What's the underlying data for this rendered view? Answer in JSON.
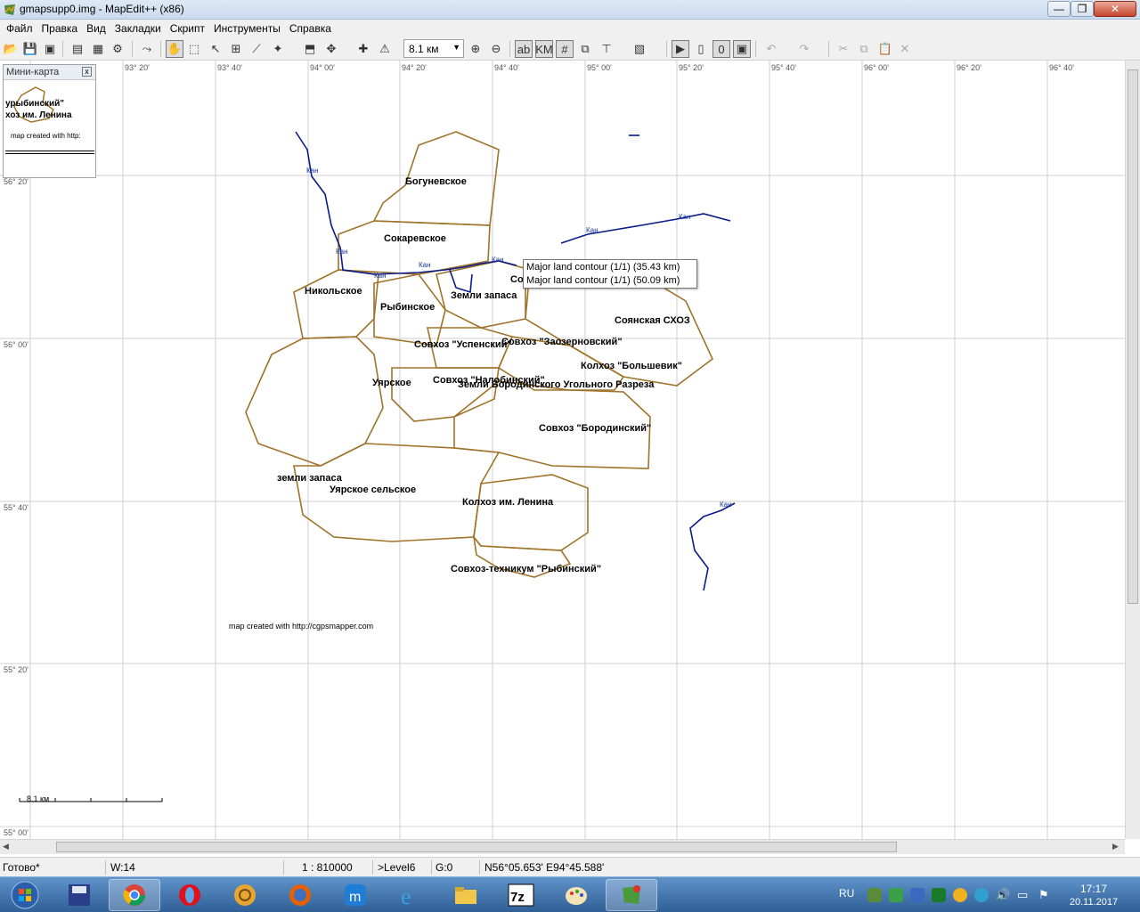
{
  "window": {
    "title": "gmapsupp0.img - MapEdit++ (x86)",
    "min_symbol": "—",
    "max_symbol": "❐",
    "close_symbol": "✕"
  },
  "menu": [
    "Файл",
    "Правка",
    "Вид",
    "Закладки",
    "Скрипт",
    "Инструменты",
    "Справка"
  ],
  "toolbar": {
    "scale_value": "8.1 км",
    "scale_arrow": "▼",
    "tool_icons": [
      "open-icon",
      "save-icon",
      "export-icon",
      "properties-icon",
      "layers-icon",
      "tools-icon",
      "route-icon",
      "hand-icon",
      "zoom-rect-icon",
      "select-icon",
      "edit-nodes-icon",
      "polyline-icon",
      "magic-wand-icon",
      "select-area-icon",
      "move-icon",
      "add-point-icon",
      "poi-icon",
      "zoom-in-icon",
      "zoom-out-icon",
      "label-icon",
      "km-icon",
      "grid-icon",
      "tree-icon",
      "split-icon",
      "image-icon",
      "layer-a-icon",
      "layer-b-icon",
      "layer-c-icon",
      "layer-d-icon",
      "undo-icon",
      "redo-icon",
      "cut-icon",
      "copy-icon",
      "paste-icon",
      "delete-icon"
    ]
  },
  "minimap": {
    "title": "Мини-карта",
    "close_symbol": "x",
    "text1": "урыбинский\"",
    "text2": "хоз им. Ленина",
    "credit": "map created with http:"
  },
  "grid": {
    "longitudes": [
      "93° 20'",
      "93° 40'",
      "94° 00'",
      "94° 20'",
      "94° 40'",
      "95° 00'",
      "95° 20'",
      "95° 40'",
      "96° 00'",
      "96° 20'",
      "96° 40'"
    ],
    "latitudes": [
      "56° 20'",
      "56° 00'",
      "55° 40'",
      "55° 20'",
      "55° 00'"
    ]
  },
  "map_labels": [
    "Богуневское",
    "Сокаревское",
    "Никольское",
    "Рыбинское",
    "Земли запаса",
    "Соянская СХОЗ",
    "Совхоз \"Успенский\"",
    "Совхоз \"Заозерновский\"",
    "Колхоз \"Большевик\"",
    "Уярское",
    "Совхоз \"Налобинский\"",
    "Земли Бородинского Угольного Разреза",
    "Совхоз \"Бородинский\"",
    "земли запаса",
    "Уярское сельское",
    "Колхоз им. Ленина",
    "Совхоз-техникум \"Рыбинский\"",
    "Со"
  ],
  "river_labels": [
    "Кан",
    "Кан",
    "Кан",
    "Кан",
    "Кан",
    "Кан",
    "Кан",
    "Кан"
  ],
  "credit": "map created with http://cgpsmapper.com",
  "scalebar": "8.1 км",
  "tooltip": {
    "line1": "Major land contour (1/1) (35.43 km)",
    "line2": "Major land contour (1/1) (50.09 km)"
  },
  "statusbar": {
    "status": "Готово*",
    "w": "W:14",
    "scale": "1 : 810000",
    "level": ">Level6",
    "g": "G:0",
    "coords": "N56°05.653' E94°45.588'"
  },
  "taskbar": {
    "apps": [
      "start-button",
      "save-app-icon",
      "chrome-icon",
      "opera-icon",
      "navigator-icon",
      "firefox-icon",
      "maxthon-icon",
      "ie-icon",
      "explorer-icon",
      "7zip-icon",
      "paint-icon",
      "mapedit-icon"
    ],
    "lang": "RU",
    "time": "17:17",
    "date": "20.11.2017"
  },
  "colors": {
    "boundary": "#a0732a",
    "river": "#0a1a8a",
    "grid": "#cfcfcf"
  }
}
